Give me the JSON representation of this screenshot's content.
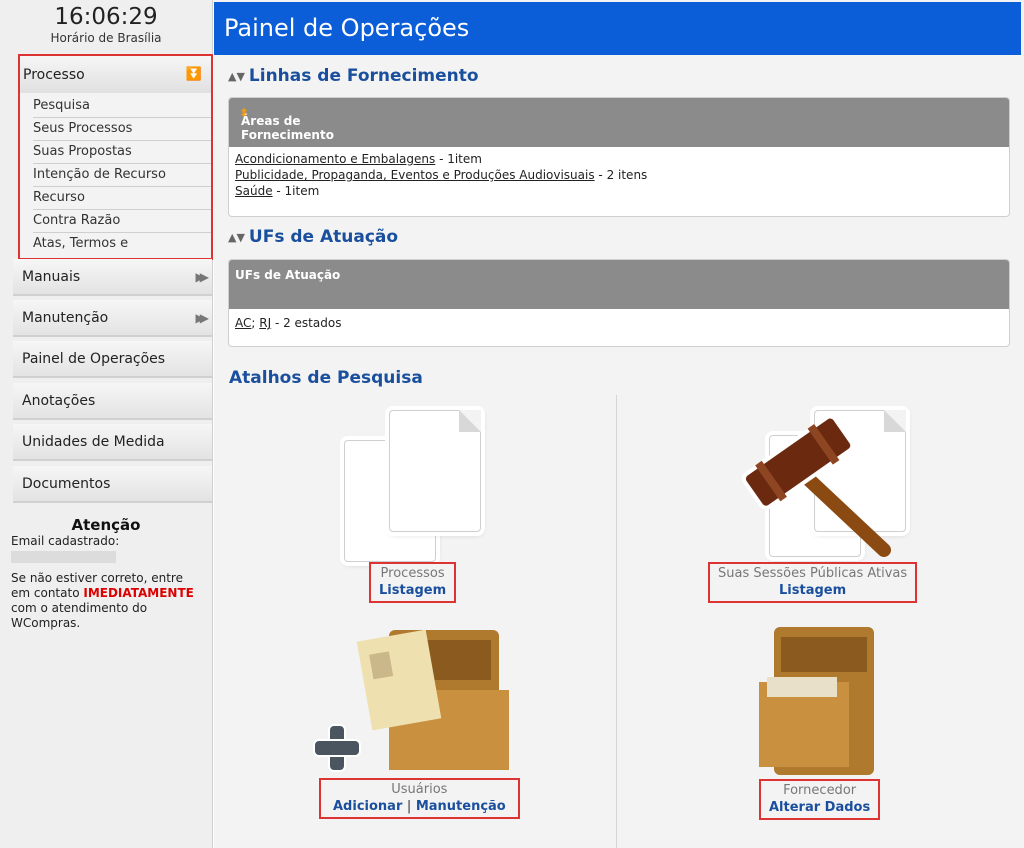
{
  "clock": {
    "time": "16:06:29",
    "timezone": "Horário de Brasília"
  },
  "sidebar": {
    "processo": {
      "label": "Processo",
      "items": [
        "Pesquisa",
        "Seus Processos",
        "Suas Propostas",
        "Intenção de Recurso",
        "Recurso",
        "Contra Razão",
        "Atas, Termos e Documentos"
      ]
    },
    "menu": [
      {
        "label": "Manuais",
        "arrow": "▶▶"
      },
      {
        "label": "Manutenção",
        "arrow": "▶▶"
      },
      {
        "label": "Painel de Operações",
        "arrow": ""
      },
      {
        "label": "Anotações",
        "arrow": ""
      },
      {
        "label": "Unidades de Medida",
        "arrow": ""
      },
      {
        "label": "Documentos",
        "arrow": ""
      }
    ],
    "attention": {
      "title": "Atenção",
      "email_label": "Email cadastrado:",
      "msg_before": "Se não estiver correto, entre em contato ",
      "msg_highlight": "IMEDIATAMENTE",
      "msg_after": " com o atendimento do WCompras."
    }
  },
  "header": {
    "title": "Painel de Operações"
  },
  "linhas": {
    "title": "Linhas de Fornecimento",
    "panel_header": "Áreas de Fornecimento",
    "rows": [
      {
        "link": "Acondicionamento e Embalagens",
        "count": " - 1item"
      },
      {
        "link": "Publicidade, Propaganda, Eventos e Produções Audiovisuais",
        "count": " - 2 itens"
      },
      {
        "link": "Saúde",
        "count": " - 1item"
      }
    ]
  },
  "ufs": {
    "title": "UFs de Atuação",
    "panel_header": "UFs de Atuação",
    "uf1": "AC",
    "sep": "; ",
    "uf2": "RJ",
    "count": " - 2 estados"
  },
  "atalhos": {
    "title": "Atalhos de Pesquisa",
    "processos": {
      "title": "Processos",
      "link": "Listagem"
    },
    "sessoes": {
      "title": "Suas Sessões Públicas Ativas",
      "link": "Listagem"
    },
    "usuarios": {
      "title": "Usuários",
      "link1": "Adicionar",
      "sep": "|",
      "link2": "Manutenção"
    },
    "fornecedor": {
      "title": "Fornecedor",
      "link": "Alterar Dados"
    }
  },
  "colors": {
    "header_blue": "#0b5ed7",
    "link_blue": "#1a4f9e",
    "highlight_red": "#dd3333"
  }
}
